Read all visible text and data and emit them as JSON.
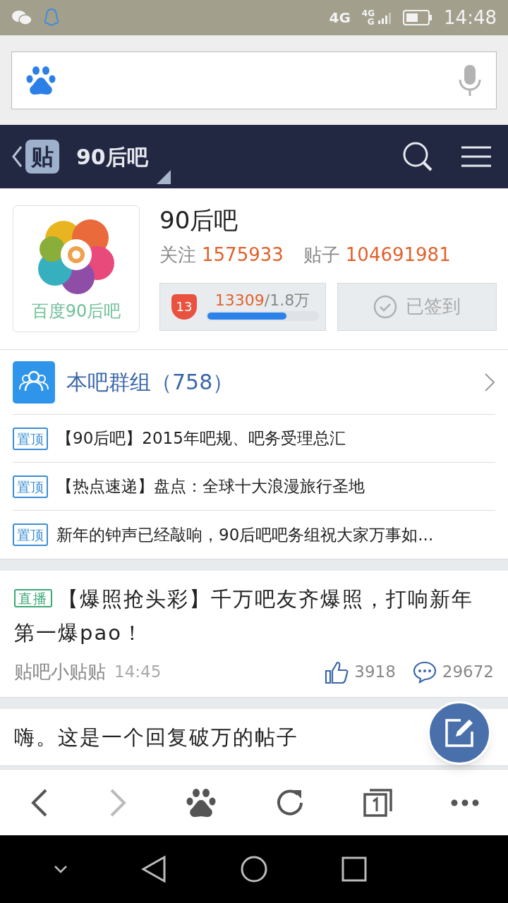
{
  "status_bar": {
    "network": "4G",
    "network_2": "4G",
    "network_3": "G",
    "time": "14:48"
  },
  "header": {
    "logo": "贴",
    "title": "90后吧"
  },
  "forum": {
    "avatar_caption": "百度90后吧",
    "name": "90后吧",
    "follow_label": "关注",
    "follow_count": "1575933",
    "posts_label": "贴子",
    "posts_count": "104691981",
    "level_badge": "13",
    "exp": "13309",
    "exp_total": "/1.8万",
    "level": 0.72,
    "sign_in": "已签到",
    "signed": true
  },
  "group": {
    "title": "本吧群组（758）"
  },
  "pinned": [
    {
      "tag": "置顶",
      "color": "#3a8ed6",
      "title": "【90后吧】2015年吧规、吧务受理总汇"
    },
    {
      "tag": "置顶",
      "color": "#3a8ed6",
      "title": "【热点速递】盘点：全球十大浪漫旅行圣地"
    },
    {
      "tag": "置顶",
      "color": "#3a8ed6",
      "title": "新年的钟声已经敲响，90后吧吧务组祝大家万事如..."
    }
  ],
  "posts": [
    {
      "tag": "直播",
      "color": "#3aa876",
      "title": "【爆照抢头彩】千万吧友齐爆照，打响新年第一爆pao！",
      "author": "贴吧小贴贴",
      "time": "14:45",
      "likes": "3918",
      "replies": "29672"
    },
    {
      "title": "嗨。这是一个回复破万的帖子"
    }
  ]
}
